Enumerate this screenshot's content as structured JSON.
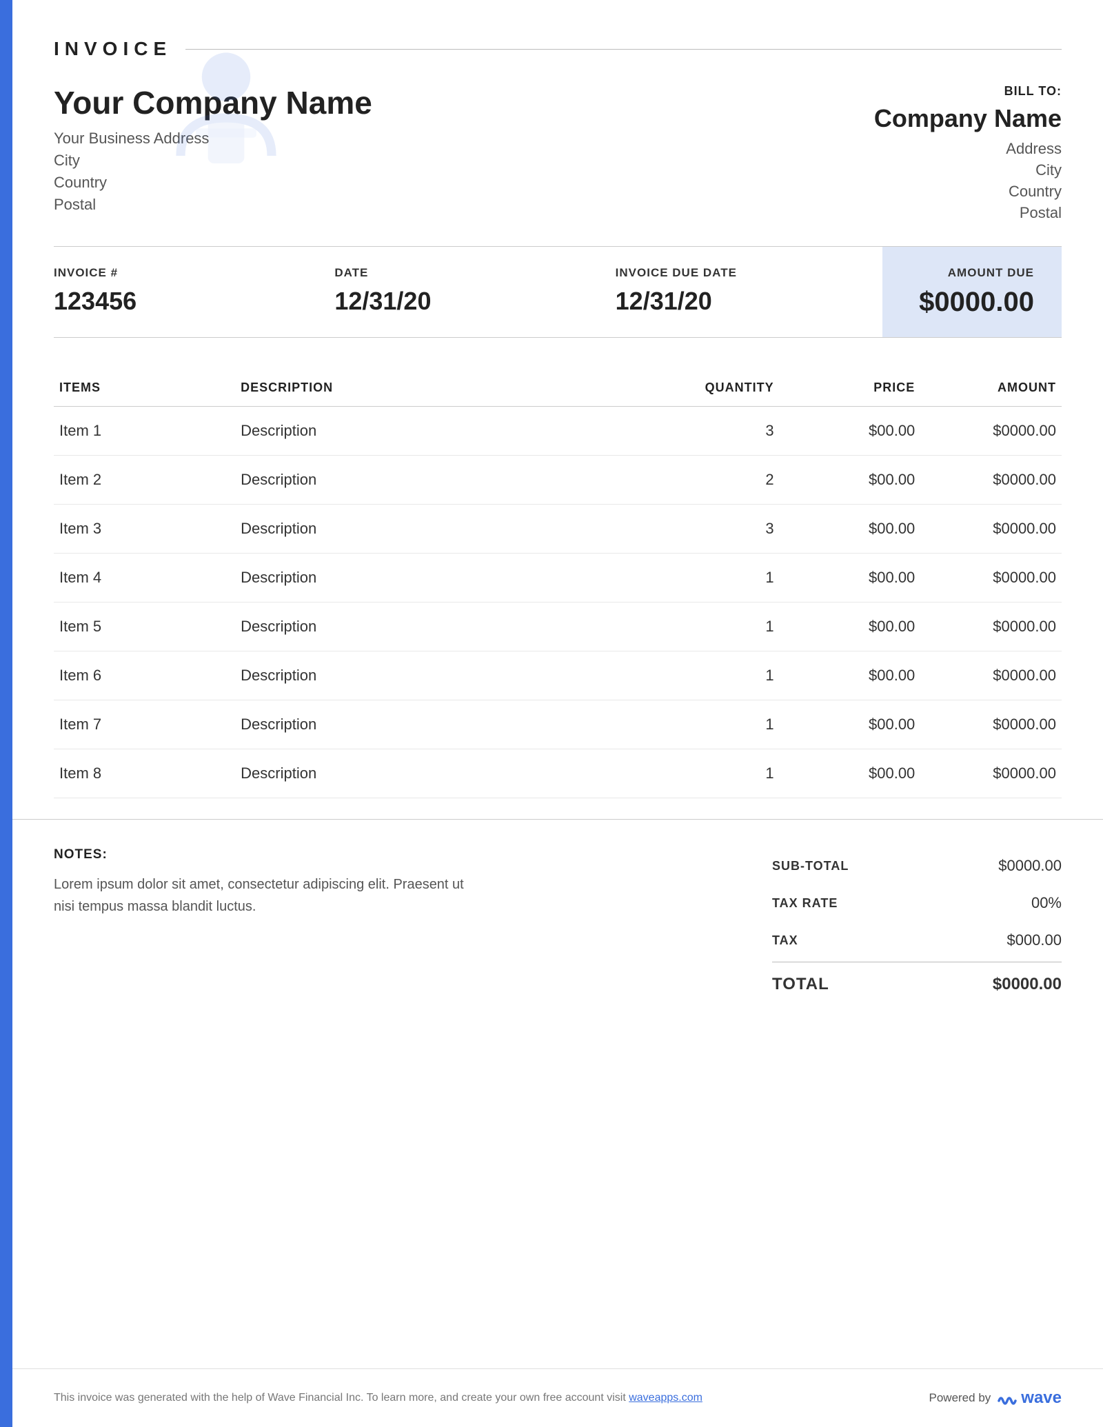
{
  "invoice": {
    "title": "INVOICE",
    "company": {
      "name": "Your Company Name",
      "address": "Your Business Address",
      "city": "City",
      "country": "Country",
      "postal": "Postal"
    },
    "bill_to": {
      "label": "BILL TO:",
      "name": "Company Name",
      "address": "Address",
      "city": "City",
      "country": "Country",
      "postal": "Postal"
    },
    "meta": {
      "invoice_number_label": "INVOICE #",
      "invoice_number": "123456",
      "date_label": "DATE",
      "date": "12/31/20",
      "due_date_label": "INVOICE DUE DATE",
      "due_date": "12/31/20",
      "amount_due_label": "AMOUNT DUE",
      "amount_due": "$0000.00"
    },
    "table": {
      "col_items": "ITEMS",
      "col_description": "DESCRIPTION",
      "col_quantity": "QUANTITY",
      "col_price": "PRICE",
      "col_amount": "AMOUNT",
      "rows": [
        {
          "item": "Item 1",
          "description": "Description",
          "quantity": "3",
          "price": "$00.00",
          "amount": "$0000.00"
        },
        {
          "item": "Item 2",
          "description": "Description",
          "quantity": "2",
          "price": "$00.00",
          "amount": "$0000.00"
        },
        {
          "item": "Item 3",
          "description": "Description",
          "quantity": "3",
          "price": "$00.00",
          "amount": "$0000.00"
        },
        {
          "item": "Item 4",
          "description": "Description",
          "quantity": "1",
          "price": "$00.00",
          "amount": "$0000.00"
        },
        {
          "item": "Item 5",
          "description": "Description",
          "quantity": "1",
          "price": "$00.00",
          "amount": "$0000.00"
        },
        {
          "item": "Item 6",
          "description": "Description",
          "quantity": "1",
          "price": "$00.00",
          "amount": "$0000.00"
        },
        {
          "item": "Item 7",
          "description": "Description",
          "quantity": "1",
          "price": "$00.00",
          "amount": "$0000.00"
        },
        {
          "item": "Item 8",
          "description": "Description",
          "quantity": "1",
          "price": "$00.00",
          "amount": "$0000.00"
        }
      ]
    },
    "notes": {
      "label": "NOTES:",
      "text": "Lorem ipsum dolor sit amet, consectetur adipiscing elit. Praesent ut nisi tempus massa blandit luctus."
    },
    "totals": {
      "subtotal_label": "SUB-TOTAL",
      "subtotal_value": "$0000.00",
      "tax_rate_label": "TAX RATE",
      "tax_rate_value": "00%",
      "tax_label": "TAX",
      "tax_value": "$000.00",
      "total_label": "TOTAL",
      "total_value": "$0000.00"
    },
    "footer": {
      "note": "This invoice was generated with the help of Wave Financial Inc. To learn more, and create your own free account visit",
      "link_text": "waveapps.com",
      "powered_by": "Powered by",
      "wave_label": "wave"
    }
  }
}
